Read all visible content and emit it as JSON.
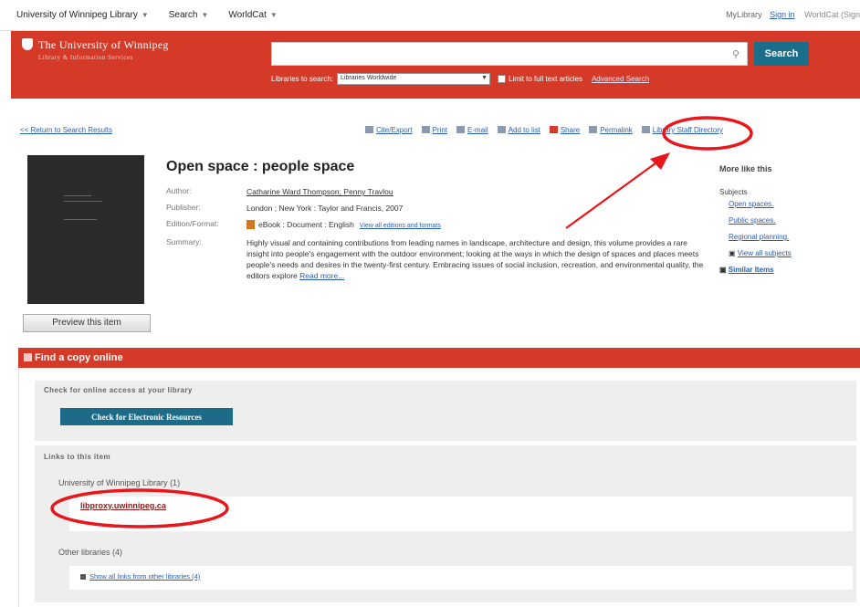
{
  "topbar": {
    "nav": [
      {
        "label": "University of Winnipeg Library"
      },
      {
        "label": "Search"
      },
      {
        "label": "WorldCat"
      }
    ],
    "my_library": "MyLibrary",
    "sign_in": "Sign in",
    "worldcat_sign": "WorldCat (Sign"
  },
  "header": {
    "logo_line1": "The University of Winnipeg",
    "logo_line2": "Library & Information Services",
    "search_button": "Search",
    "libraries_label": "Libraries to search:",
    "libraries_value": "Libraries Worldwide",
    "fulltext_label": "Limit to full text articles",
    "advanced": "Advanced Search"
  },
  "actions": {
    "back": "<< Return to Search Results",
    "tools": [
      {
        "label": "Cite/Export",
        "icon": "cite-icon"
      },
      {
        "label": "Print",
        "icon": "print-icon"
      },
      {
        "label": "E-mail",
        "icon": "email-icon"
      },
      {
        "label": "Add to list",
        "icon": "list-icon"
      },
      {
        "label": "Share",
        "icon": "share-icon"
      },
      {
        "label": "Permalink",
        "icon": "link-icon"
      },
      {
        "label": "Library Staff Directory",
        "icon": "staff-icon"
      }
    ]
  },
  "item": {
    "title": "Open space : people space",
    "labels": {
      "author": "Author:",
      "publisher": "Publisher:",
      "edition": "Edition/Format:",
      "summary": "Summary:"
    },
    "author": "Catharine Ward Thompson; Penny Travlou",
    "publisher": "London ; New York : Taylor and Francis, 2007",
    "edition": "eBook : Document : English",
    "edition_link": "View all editions and formats",
    "summary": "Highly visual and containing contributions from leading names in landscape, architecture and design, this volume provides a rare insight into people's engagement with the outdoor environment; looking at the ways in which the design of spaces and places meets people's needs and desires in the twenty-first century. Embracing issues of social inclusion, recreation, and environmental quality, the editors explore",
    "read_more": "Read more...",
    "preview_button": "Preview this item"
  },
  "more_like_this": {
    "heading": "More like this",
    "subjects_label": "Subjects",
    "subjects": [
      "Open spaces.",
      "Public spaces.",
      "Regional planning."
    ],
    "view_all": "View all subjects",
    "similar": "Similar Items"
  },
  "find_copy": {
    "title": "Find a copy online",
    "check_heading": "Check for online access at your library",
    "check_button": "Check for Electronic Resources",
    "links_heading": "Links to this item",
    "uw_label": "University of Winnipeg Library",
    "uw_count": "(1)",
    "uw_link": "libproxy.uwinnipeg.ca",
    "other_label": "Other libraries",
    "other_count": "(4)",
    "other_link": "Show all links from other libraries (4)"
  },
  "colors": {
    "brand_red": "#d43a27",
    "button_teal": "#1d6b86",
    "annotation_red": "#e8171b"
  }
}
